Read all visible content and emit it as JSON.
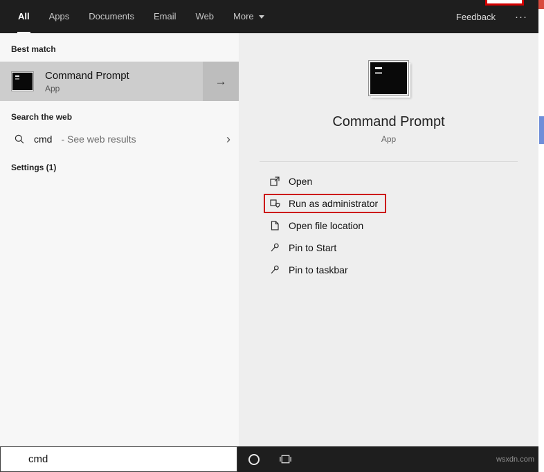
{
  "header": {
    "tabs": [
      {
        "label": "All",
        "active": true
      },
      {
        "label": "Apps",
        "active": false
      },
      {
        "label": "Documents",
        "active": false
      },
      {
        "label": "Email",
        "active": false
      },
      {
        "label": "Web",
        "active": false
      },
      {
        "label": "More",
        "active": false,
        "has_dropdown": true
      }
    ],
    "feedback": "Feedback"
  },
  "icons": {
    "ellipsis": "···",
    "arrow_right": "→",
    "chevron_right": "›"
  },
  "left_panel": {
    "sections": {
      "best_match": "Best match",
      "search_web": "Search the web",
      "settings": "Settings (1)"
    },
    "best_match_item": {
      "title": "Command Prompt",
      "subtitle": "App"
    },
    "web_item": {
      "query": "cmd",
      "suffix": "- See web results"
    }
  },
  "preview": {
    "title": "Command Prompt",
    "subtitle": "App",
    "actions": [
      {
        "label": "Open",
        "highlighted": false
      },
      {
        "label": "Run as administrator",
        "highlighted": true
      },
      {
        "label": "Open file location",
        "highlighted": false
      },
      {
        "label": "Pin to Start",
        "highlighted": false
      },
      {
        "label": "Pin to taskbar",
        "highlighted": false
      }
    ]
  },
  "taskbar": {
    "search_value": "cmd"
  },
  "watermark": "wsxdn.com",
  "colors": {
    "highlight_box": "#cc0000",
    "bar_bg": "#1e1e1e",
    "accent": "#0078d7"
  }
}
